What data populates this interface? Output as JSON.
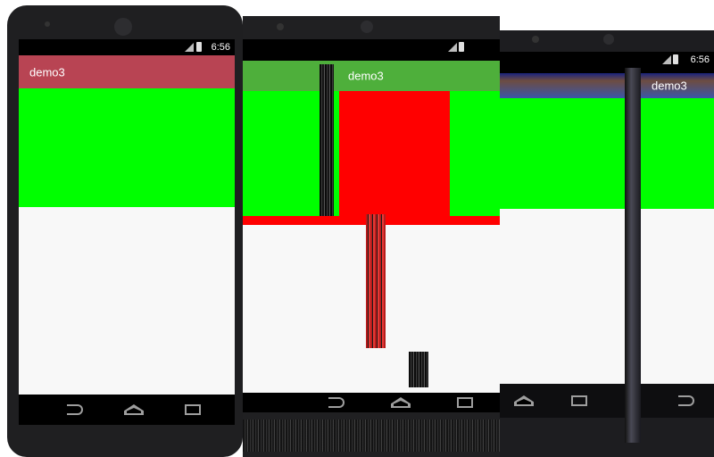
{
  "screens": [
    {
      "title": "demo3",
      "status_time": "6:56",
      "colors": {
        "appbar": "#b84453",
        "content_top": "#00ff00",
        "content_bottom": "#f8f8f8"
      }
    },
    {
      "title": "demo3",
      "colors": {
        "appbar": "#4eaf3b",
        "content_top": "#00ff00",
        "inner_box": "#ff0000",
        "content_bottom": "#f8f8f8"
      }
    },
    {
      "title": "demo3",
      "status_time": "6:56",
      "colors": {
        "appbar": "#3b56a8",
        "content_top": "#00ff00",
        "content_bottom": "#f8f8f8"
      }
    }
  ],
  "nav_icons": [
    "back-icon",
    "home-icon",
    "recent-apps-icon"
  ]
}
